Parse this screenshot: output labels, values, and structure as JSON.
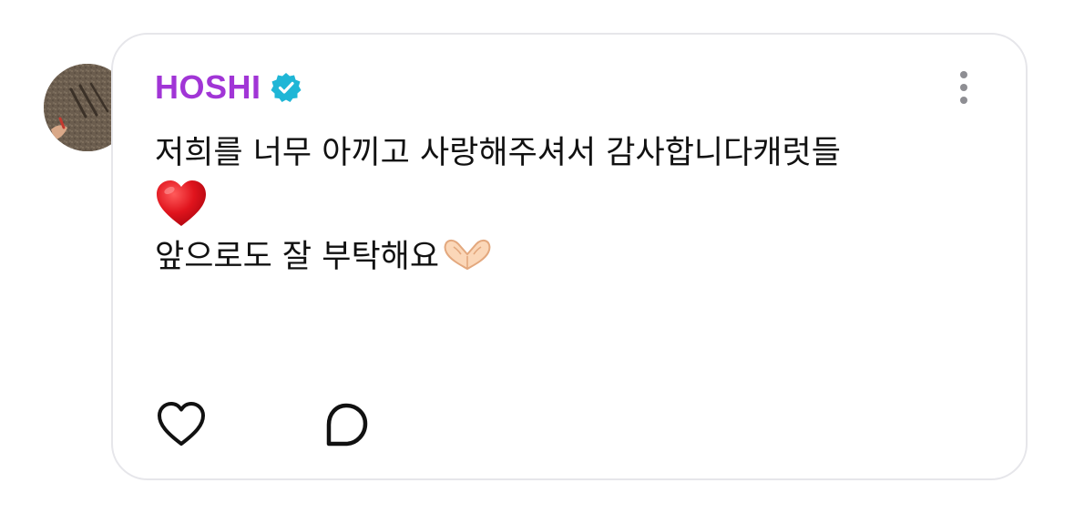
{
  "post": {
    "author": "HOSHI",
    "verified": true,
    "lines": [
      "저희를 너무 아끼고 사랑해주셔서 감사합니다캐럿들",
      "앞으로도 잘 부탁해요"
    ],
    "emojis": [
      "red-heart",
      "heart-hands"
    ]
  },
  "colors": {
    "author": "#a135d6",
    "verified_badge": "#1fb6d6",
    "heart": "#d6141c",
    "text": "#111111",
    "border": "#e6e6ea"
  },
  "icons": {
    "more": "vertical-ellipsis-icon",
    "like": "heart-outline-icon",
    "reply": "speech-bubble-icon"
  }
}
